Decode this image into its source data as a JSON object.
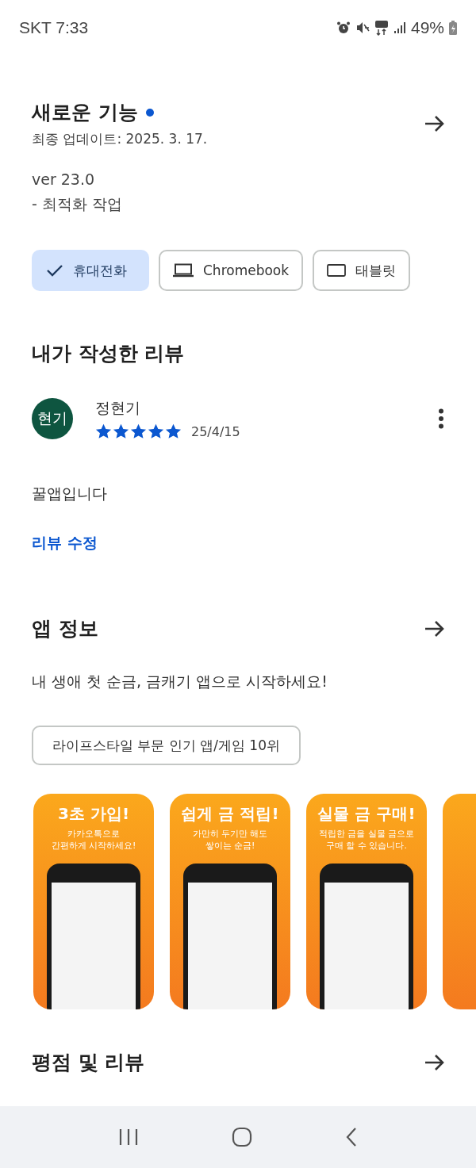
{
  "status_bar": {
    "carrier_time": "SKT 7:33",
    "battery": "49%"
  },
  "whats_new": {
    "title": "새로운 기능",
    "subtitle": "최종 업데이트: 2025. 3. 17.",
    "lines": [
      "ver 23.0",
      "- 최적화 작업"
    ]
  },
  "devices": [
    {
      "label": "휴대전화",
      "selected": true
    },
    {
      "label": "Chromebook",
      "kind": "laptop",
      "selected": false
    },
    {
      "label": "태블릿",
      "kind": "tablet",
      "selected": false
    }
  ],
  "my_review": {
    "title": "내가 작성한 리뷰",
    "avatar": "현기",
    "name": "정현기",
    "stars": 5,
    "date": "25/4/15",
    "text": "꿀앱입니다",
    "edit_link": "리뷰 수정"
  },
  "app_info": {
    "title": "앱 정보",
    "description": "내 생애 첫 순금, 금캐기 앱으로 시작하세요!",
    "badge": "라이프스타일 부문 인기 앱/게임 10위"
  },
  "screenshots": [
    {
      "headline": "3초 가입!",
      "caption": "카카오톡으로\n간편하게 시작하세요!"
    },
    {
      "headline": "쉽게 금 적립!",
      "caption": "가만히 두기만 해도\n쌓이는 순금!"
    },
    {
      "headline": "실물 금 구매!",
      "caption": "적립한 금을 실물 금으로\n구매 할 수 있습니다."
    }
  ],
  "ratings": {
    "title": "평점 및 리뷰"
  }
}
